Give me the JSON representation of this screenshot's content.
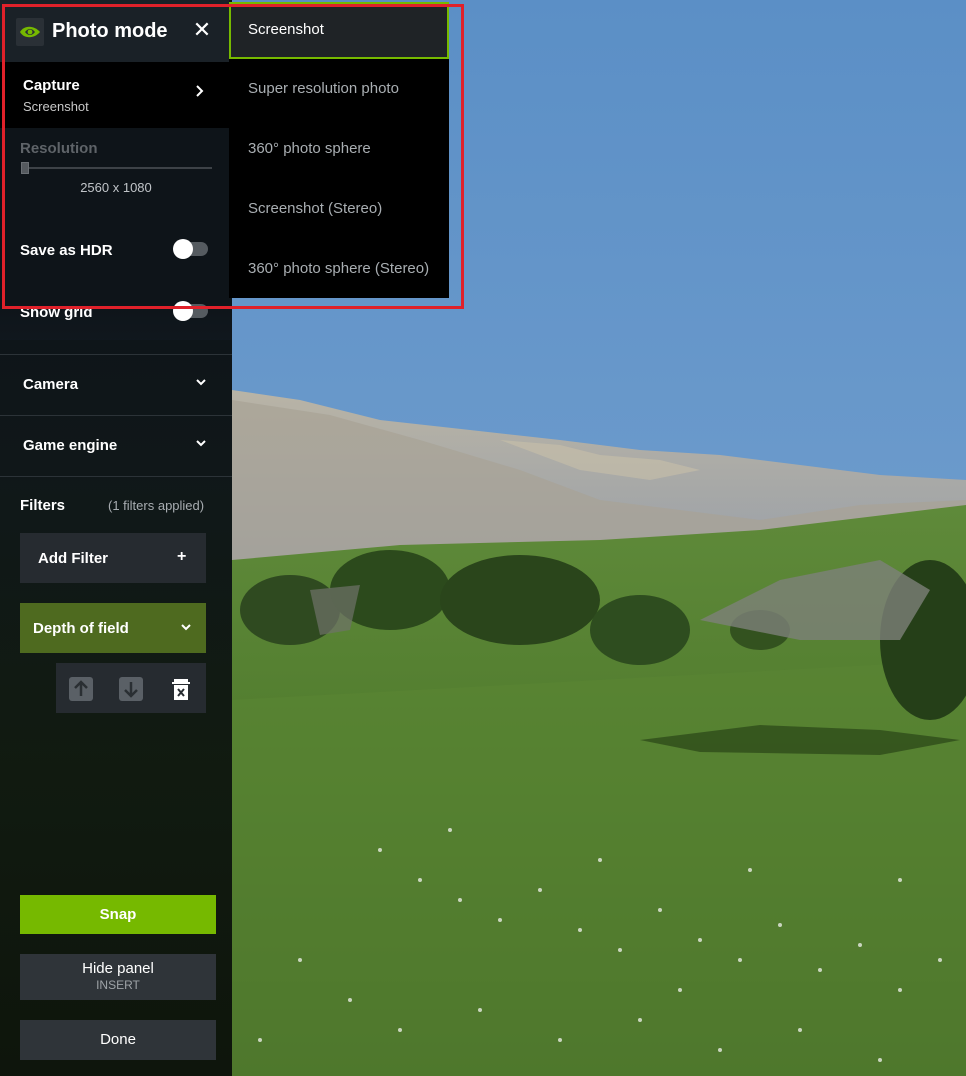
{
  "app": {
    "title": "Photo mode",
    "logo_icon": "nvidia-logo-icon",
    "accent_color": "#76b900",
    "annotation_color": "#e0212a"
  },
  "capture": {
    "label": "Capture",
    "value": "Screenshot"
  },
  "resolution": {
    "label": "Resolution",
    "value": "2560 x 1080",
    "slider_level": 0
  },
  "toggles": {
    "save_hdr": {
      "label": "Save as HDR",
      "on": false
    },
    "show_grid": {
      "label": "Show grid",
      "on": false
    }
  },
  "sections": {
    "camera": "Camera",
    "game_engine": "Game engine"
  },
  "filters": {
    "label": "Filters",
    "count_text": "(1 filters applied)",
    "add_label": "Add Filter",
    "add_icon": "+",
    "items": [
      {
        "label": "Depth of field"
      }
    ]
  },
  "actions": {
    "snap": "Snap",
    "hide_panel": "Hide panel",
    "hide_panel_shortcut": "INSERT",
    "done": "Done"
  },
  "dropdown": {
    "selected": "Screenshot",
    "options": [
      "Screenshot",
      "Super resolution photo",
      "360° photo sphere",
      "Screenshot (Stereo)",
      "360° photo sphere (Stereo)"
    ]
  }
}
